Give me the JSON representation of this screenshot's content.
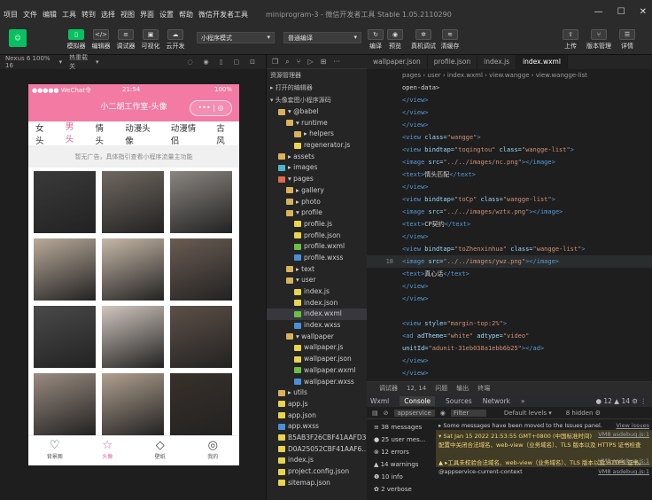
{
  "menu": {
    "items": [
      "项目",
      "文件",
      "编辑",
      "工具",
      "转到",
      "选择",
      "视图",
      "界面",
      "设置",
      "帮助",
      "微信开发者工具"
    ],
    "title": "miniprogram-3 - 微信开发者工具 Stable 1.05.2110290"
  },
  "toolbar": {
    "buttons": [
      "模拟器",
      "编辑器",
      "调试器",
      "可视化",
      "云开发"
    ],
    "mode": "小程序模式",
    "compile": "普通编译",
    "right_mid": [
      "编译",
      "预览",
      "真机调试",
      "清缓存"
    ],
    "right": [
      "上传",
      "版本管理",
      "详情"
    ]
  },
  "sim_bar": {
    "device": "Nexus 6 100% 16",
    "hot": "热重载 关"
  },
  "phone": {
    "carrier": "●●●●● WeChat令",
    "time": "21:54",
    "battery": "100%",
    "nav_title": "小二胡工作室-头像",
    "capsule": "••• | ◎",
    "tabs": [
      "女头",
      "男头",
      "情头",
      "动漫头像",
      "动漫情侣",
      "古风"
    ],
    "notice": "暂无广告，具体指引查看小程序流量主功能",
    "tabbar": [
      {
        "icon": "♡",
        "label": "背景图"
      },
      {
        "icon": "☆",
        "label": "头像"
      },
      {
        "icon": "◇",
        "label": "壁纸"
      },
      {
        "icon": "◎",
        "label": "我的"
      }
    ]
  },
  "photo_colors": [
    "#3a3a3a",
    "#706860",
    "#8a8580",
    "#b9aa9a",
    "#c7b8a8",
    "#6a5c52",
    "#4a4a4a",
    "#d0c6be",
    "#5d5047",
    "#9a8b80",
    "#b0a090",
    "#38302a"
  ],
  "explorer": {
    "title": "资源管理器",
    "open": "▸ 打开的编辑器",
    "project": "▾ 头像套图小程序源码",
    "tree": [
      {
        "t": "▾ @babel",
        "i": "#d9b25a",
        "d": 1
      },
      {
        "t": "▾ runtime",
        "i": "#d9b25a",
        "d": 2
      },
      {
        "t": "▸ helpers",
        "i": "#d9b25a",
        "d": 3
      },
      {
        "t": "regenerator.js",
        "i": "#e8d44d",
        "d": 3
      },
      {
        "t": "▸ assets",
        "i": "#d9b25a",
        "d": 1
      },
      {
        "t": "▸ images",
        "i": "#4bb8c9",
        "d": 1
      },
      {
        "t": "▾ pages",
        "i": "#e06c4a",
        "d": 1
      },
      {
        "t": "▸ gallery",
        "i": "#d9b25a",
        "d": 2
      },
      {
        "t": "▸ photo",
        "i": "#d9b25a",
        "d": 2
      },
      {
        "t": "▾ profile",
        "i": "#d9b25a",
        "d": 2
      },
      {
        "t": "profile.js",
        "i": "#e8d44d",
        "d": 3
      },
      {
        "t": "profile.json",
        "i": "#e8d44d",
        "d": 3
      },
      {
        "t": "profile.wxml",
        "i": "#6cbf43",
        "d": 3
      },
      {
        "t": "profile.wxss",
        "i": "#4a90d9",
        "d": 3
      },
      {
        "t": "▸ text",
        "i": "#d9b25a",
        "d": 2
      },
      {
        "t": "▾ user",
        "i": "#d9b25a",
        "d": 2
      },
      {
        "t": "index.js",
        "i": "#e8d44d",
        "d": 3
      },
      {
        "t": "index.json",
        "i": "#e8d44d",
        "d": 3
      },
      {
        "t": "index.wxml",
        "i": "#6cbf43",
        "d": 3,
        "sel": true
      },
      {
        "t": "index.wxss",
        "i": "#4a90d9",
        "d": 3
      },
      {
        "t": "▾ wallpaper",
        "i": "#d9b25a",
        "d": 2
      },
      {
        "t": "wallpaper.js",
        "i": "#e8d44d",
        "d": 3
      },
      {
        "t": "wallpaper.json",
        "i": "#e8d44d",
        "d": 3
      },
      {
        "t": "wallpaper.wxml",
        "i": "#6cbf43",
        "d": 3
      },
      {
        "t": "wallpaper.wxss",
        "i": "#4a90d9",
        "d": 3
      },
      {
        "t": "▸ utils",
        "i": "#d9b25a",
        "d": 1
      },
      {
        "t": "app.js",
        "i": "#e8d44d",
        "d": 1
      },
      {
        "t": "app.json",
        "i": "#e8d44d",
        "d": 1
      },
      {
        "t": "app.wxss",
        "i": "#4a90d9",
        "d": 1
      },
      {
        "t": "B5AB3F26CBF41AAFD3...",
        "i": "#e8d44d",
        "d": 1
      },
      {
        "t": "D0A25052CBF41AAF6...",
        "i": "#e8d44d",
        "d": 1
      },
      {
        "t": "index.js",
        "i": "#e8d44d",
        "d": 1
      },
      {
        "t": "project.config.json",
        "i": "#e8d44d",
        "d": 1
      },
      {
        "t": "sitemap.json",
        "i": "#e8d44d",
        "d": 1
      }
    ]
  },
  "editor": {
    "tabs": [
      "wallpaper.json",
      "profile.json",
      "index.js",
      "index.wxml"
    ],
    "crumb": "pages › user › index.wxml › view.wangge › view.wangge-list",
    "lines": [
      {
        "n": "",
        "c": [
          [
            "txt",
            "          open-data>"
          ]
        ]
      },
      {
        "n": "",
        "c": [
          [
            "tag",
            "        </view>"
          ]
        ]
      },
      {
        "n": "",
        "c": [
          [
            "tag",
            "      </view>"
          ]
        ]
      },
      {
        "n": "",
        "c": [
          [
            "tag",
            "    </view>"
          ]
        ]
      },
      {
        "n": "",
        "c": [
          [
            "tag",
            "    <view "
          ],
          [
            "attr",
            "class="
          ],
          [
            "str",
            "\"wangge\""
          ],
          [
            "tag",
            ">"
          ]
        ]
      },
      {
        "n": "",
        "c": [
          [
            "tag",
            "      <view "
          ],
          [
            "attr",
            "bindtap="
          ],
          [
            "str",
            "\"toqingtou\" "
          ],
          [
            "attr",
            "class="
          ],
          [
            "str",
            "\"wangge-list\""
          ],
          [
            "tag",
            ">"
          ]
        ]
      },
      {
        "n": "",
        "c": [
          [
            "tag",
            "        <image "
          ],
          [
            "attr",
            "src="
          ],
          [
            "str",
            "\"../../images/nc.png\""
          ],
          [
            "tag",
            "></image>"
          ]
        ]
      },
      {
        "n": "",
        "c": [
          [
            "tag",
            "        <text>"
          ],
          [
            "txt",
            "情头匹配"
          ],
          [
            "tag",
            "</text>"
          ]
        ]
      },
      {
        "n": "",
        "c": [
          [
            "tag",
            "      </view>"
          ]
        ]
      },
      {
        "n": "",
        "c": [
          [
            "tag",
            "      <view "
          ],
          [
            "attr",
            "bindtap="
          ],
          [
            "str",
            "\"toCp\" "
          ],
          [
            "attr",
            "class="
          ],
          [
            "str",
            "\"wangge-list\""
          ],
          [
            "tag",
            ">"
          ]
        ]
      },
      {
        "n": "",
        "c": [
          [
            "tag",
            "        <image "
          ],
          [
            "attr",
            "src="
          ],
          [
            "str",
            "\"../../images/wztx.png\""
          ],
          [
            "tag",
            "></image>"
          ]
        ]
      },
      {
        "n": "",
        "c": [
          [
            "tag",
            "        <text>"
          ],
          [
            "txt",
            "CP契约"
          ],
          [
            "tag",
            "</text>"
          ]
        ]
      },
      {
        "n": "",
        "c": [
          [
            "tag",
            "      </view>"
          ]
        ]
      },
      {
        "n": "",
        "c": [
          [
            "tag",
            "      <view "
          ],
          [
            "attr",
            "bindtap="
          ],
          [
            "str",
            "\"toZhenxinhua\" "
          ],
          [
            "attr",
            "class="
          ],
          [
            "str",
            "\"wangge-list\""
          ],
          [
            "tag",
            ">"
          ]
        ]
      },
      {
        "n": "18",
        "c": [
          [
            "tag",
            "        <image "
          ],
          [
            "attr",
            "src="
          ],
          [
            "str",
            "\"../../images/ywz.png\""
          ],
          [
            "tag",
            "></image>"
          ]
        ]
      },
      {
        "n": "",
        "c": [
          [
            "tag",
            "        <text>"
          ],
          [
            "txt",
            "真心话"
          ],
          [
            "tag",
            "</text>"
          ]
        ]
      },
      {
        "n": "",
        "c": [
          [
            "tag",
            "      </view>"
          ]
        ]
      },
      {
        "n": "",
        "c": [
          [
            "tag",
            "    </view>"
          ]
        ]
      },
      {
        "n": "",
        "c": [
          [
            "txt",
            ""
          ]
        ]
      },
      {
        "n": "",
        "c": [
          [
            "tag",
            "    <view "
          ],
          [
            "attr",
            "style="
          ],
          [
            "str",
            "\"margin-top:2%\""
          ],
          [
            "tag",
            ">"
          ]
        ]
      },
      {
        "n": "",
        "c": [
          [
            "tag",
            "      <ad "
          ],
          [
            "attr",
            "adTheme="
          ],
          [
            "str",
            "\"white\" "
          ],
          [
            "attr",
            "adtype="
          ],
          [
            "str",
            "\"video\""
          ]
        ]
      },
      {
        "n": "",
        "c": [
          [
            "attr",
            "      unitId="
          ],
          [
            "str",
            "\"adunit-31eb038a1ebb6b25\""
          ],
          [
            "tag",
            "></ad>"
          ]
        ]
      },
      {
        "n": "",
        "c": [
          [
            "tag",
            "    </view>"
          ]
        ]
      },
      {
        "n": "",
        "c": [
          [
            "tag",
            "  </view>"
          ]
        ]
      }
    ]
  },
  "devtools": {
    "top": [
      "调试器",
      "12, 14",
      "问题",
      "输出",
      "终端"
    ],
    "tabs": [
      "Wxml",
      "Console",
      "Sources",
      "Network",
      "»"
    ],
    "badges": "● 12 ▲ 14 ⚙ ⋮",
    "context": "appservice",
    "filter": "Filter",
    "levels": "Default levels ▾",
    "hidden": "8 hidden ⚙",
    "side": [
      "≡ 38 messages",
      "● 25 user mes...",
      "⊗ 12 errors",
      "▲ 14 warnings",
      "❶ 10 info",
      "✿ 2 verbose"
    ],
    "msgs": [
      {
        "w": false,
        "t": "▸ Some messages have been moved to the Issues panel.",
        "l": "View issues"
      },
      {
        "w": true,
        "t": "▾ Sat Jan 15 2022 21:53:55 GMT+0800 (中国标准时间) 配置中关闭合法域名、web-view（业务域名）、TLS 版本以及 HTTPS 证书检查",
        "l": "VM8 asdebug.js:1"
      },
      {
        "w": true,
        "t": "▲ ▸工具未校验合法域名、web-view（业务域名）、TLS 版本以及 HTTPS 证书。",
        "l": "VM8 asdebug.js:1"
      },
      {
        "w": false,
        "t": "@appservice-current-context",
        "l": "VM8 asdebug.js:1"
      }
    ]
  }
}
